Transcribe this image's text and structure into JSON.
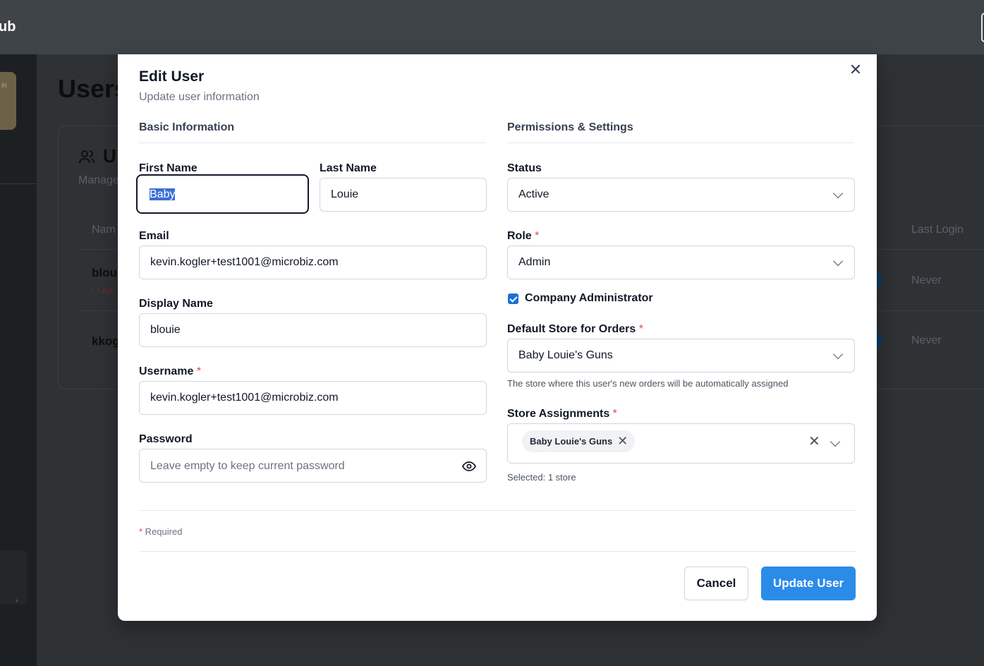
{
  "app": {
    "brand": "ub"
  },
  "background": {
    "side_card_text": "in",
    "page_title": "Users",
    "card_title": "U",
    "card_subtitle": "Manage",
    "table_headers": {
      "name": "Nam",
      "last_login": "Last Login"
    },
    "rows": [
      {
        "name": "bloui",
        "badge": "Ad",
        "last_login": "Never"
      },
      {
        "name": "kkog",
        "badge": "",
        "last_login": "Never"
      }
    ]
  },
  "modal": {
    "title": "Edit User",
    "subtitle": "Update user information",
    "close_icon": "close-icon",
    "sections": {
      "basic": "Basic Information",
      "permissions": "Permissions & Settings"
    },
    "fields": {
      "first_name": {
        "label": "First Name",
        "value": "Baby",
        "focused": true,
        "text_selected": true
      },
      "last_name": {
        "label": "Last Name",
        "value": "Louie"
      },
      "email": {
        "label": "Email",
        "value": "kevin.kogler+test1001@microbiz.com"
      },
      "display_name": {
        "label": "Display Name",
        "value": "blouie"
      },
      "username": {
        "label": "Username",
        "required": "*",
        "value": "kevin.kogler+test1001@microbiz.com"
      },
      "password": {
        "label": "Password",
        "placeholder": "Leave empty to keep current password",
        "value": ""
      },
      "status": {
        "label": "Status",
        "value": "Active"
      },
      "role": {
        "label": "Role",
        "required": "*",
        "value": "Admin"
      },
      "company_admin": {
        "label": "Company Administrator",
        "checked": true
      },
      "default_store": {
        "label": "Default Store for Orders",
        "required": "*",
        "value": "Baby Louie's Guns",
        "helper": "The store where this user's new orders will be automatically assigned"
      },
      "store_assignments": {
        "label": "Store Assignments",
        "required": "*",
        "chips": [
          "Baby Louie's Guns"
        ],
        "helper": "Selected: 1 store"
      }
    },
    "required_note": {
      "star": "*",
      "text": " Required"
    },
    "buttons": {
      "cancel": "Cancel",
      "submit": "Update User"
    },
    "colors": {
      "accent": "#2b8be8",
      "required": "#ef4444",
      "checkbox": "#1d6fd6"
    }
  }
}
